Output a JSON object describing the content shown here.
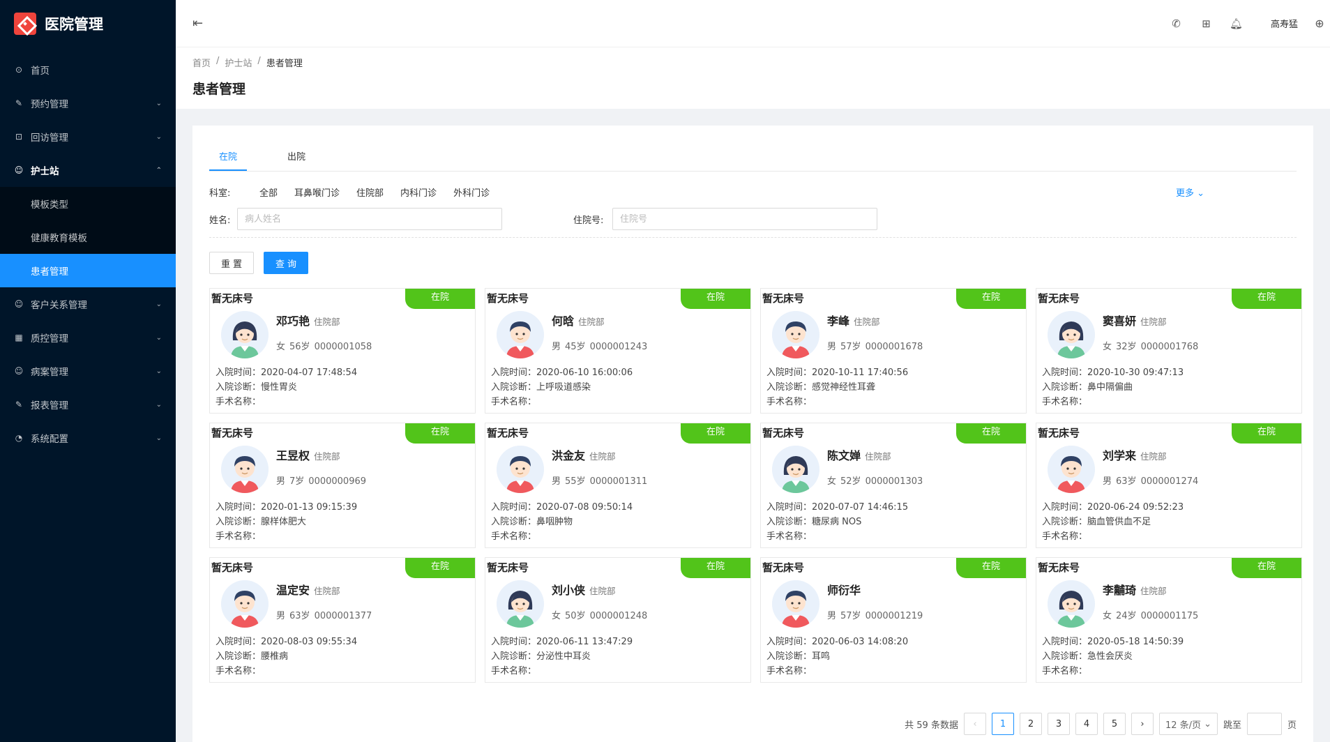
{
  "app": {
    "title": "医院管理"
  },
  "menu": {
    "home": "首页",
    "appointment": "预约管理",
    "followup": "回访管理",
    "nurse": "护士站",
    "nurse_sub": [
      "模板类型",
      "健康教育模板",
      "患者管理"
    ],
    "crm": "客户关系管理",
    "quality": "质控管理",
    "records": "病案管理",
    "reports": "报表管理",
    "settings": "系统配置"
  },
  "header": {
    "user": "高寿猛"
  },
  "breadcrumb": [
    "首页",
    "护士站",
    "患者管理"
  ],
  "page_title": "患者管理",
  "tabs": [
    "在院",
    "出院"
  ],
  "filters": {
    "dept_label": "科室:",
    "depts": [
      "全部",
      "耳鼻喉门诊",
      "住院部",
      "内科门诊",
      "外科门诊"
    ],
    "more": "更多",
    "name_label": "姓名:",
    "name_placeholder": "病人姓名",
    "admission_label": "住院号:",
    "admission_placeholder": "住院号"
  },
  "buttons": {
    "reset": "重置",
    "query": "查询"
  },
  "card_labels": {
    "admit_time": "入院时间：",
    "admit_diag": "入院诊断：",
    "surgery": "手术名称："
  },
  "patients": [
    {
      "bed": "暂无床号",
      "status": "在院",
      "name": "邓巧艳",
      "dept": "住院部",
      "sex": "女",
      "age": "56岁",
      "id": "0000001058",
      "time": "2020-04-07 17:48:54",
      "diag": "慢性胃炎",
      "surgery": ""
    },
    {
      "bed": "暂无床号",
      "status": "在院",
      "name": "何晗",
      "dept": "住院部",
      "sex": "男",
      "age": "45岁",
      "id": "0000001243",
      "time": "2020-06-10 16:00:06",
      "diag": "上呼吸道感染",
      "surgery": ""
    },
    {
      "bed": "暂无床号",
      "status": "在院",
      "name": "李峰",
      "dept": "住院部",
      "sex": "男",
      "age": "57岁",
      "id": "0000001678",
      "time": "2020-10-11 17:40:56",
      "diag": "感觉神经性耳聋",
      "surgery": ""
    },
    {
      "bed": "暂无床号",
      "status": "在院",
      "name": "窦喜妍",
      "dept": "住院部",
      "sex": "女",
      "age": "32岁",
      "id": "0000001768",
      "time": "2020-10-30 09:47:13",
      "diag": "鼻中隔偏曲",
      "surgery": ""
    },
    {
      "bed": "暂无床号",
      "status": "在院",
      "name": "王昱权",
      "dept": "住院部",
      "sex": "男",
      "age": "7岁",
      "id": "0000000969",
      "time": "2020-01-13 09:15:39",
      "diag": "腺样体肥大",
      "surgery": ""
    },
    {
      "bed": "暂无床号",
      "status": "在院",
      "name": "洪金友",
      "dept": "住院部",
      "sex": "男",
      "age": "55岁",
      "id": "0000001311",
      "time": "2020-07-08 09:50:14",
      "diag": "鼻咽肿物",
      "surgery": ""
    },
    {
      "bed": "暂无床号",
      "status": "在院",
      "name": "陈文婵",
      "dept": "住院部",
      "sex": "女",
      "age": "52岁",
      "id": "0000001303",
      "time": "2020-07-07 14:46:15",
      "diag": "糖尿病 NOS",
      "surgery": ""
    },
    {
      "bed": "暂无床号",
      "status": "在院",
      "name": "刘学来",
      "dept": "住院部",
      "sex": "男",
      "age": "63岁",
      "id": "0000001274",
      "time": "2020-06-24 09:52:23",
      "diag": "脑血管供血不足",
      "surgery": ""
    },
    {
      "bed": "暂无床号",
      "status": "在院",
      "name": "温定安",
      "dept": "住院部",
      "sex": "男",
      "age": "63岁",
      "id": "0000001377",
      "time": "2020-08-03 09:55:34",
      "diag": "腰椎病",
      "surgery": ""
    },
    {
      "bed": "暂无床号",
      "status": "在院",
      "name": "刘小侠",
      "dept": "住院部",
      "sex": "女",
      "age": "50岁",
      "id": "0000001248",
      "time": "2020-06-11 13:47:29",
      "diag": "分泌性中耳炎",
      "surgery": ""
    },
    {
      "bed": "暂无床号",
      "status": "在院",
      "name": "师衍华",
      "dept": "",
      "sex": "男",
      "age": "57岁",
      "id": "0000001219",
      "time": "2020-06-03 14:08:20",
      "diag": "耳鸣",
      "surgery": ""
    },
    {
      "bed": "暂无床号",
      "status": "在院",
      "name": "李黼琦",
      "dept": "住院部",
      "sex": "女",
      "age": "24岁",
      "id": "0000001175",
      "time": "2020-05-18 14:50:39",
      "diag": "急性会厌炎",
      "surgery": ""
    }
  ],
  "pagination": {
    "total": "共 59 条数据",
    "pages": [
      "1",
      "2",
      "3",
      "4",
      "5"
    ],
    "active_page": "1",
    "page_size": "12 条/页",
    "jump_label": "跳至",
    "page_suffix": "页"
  }
}
